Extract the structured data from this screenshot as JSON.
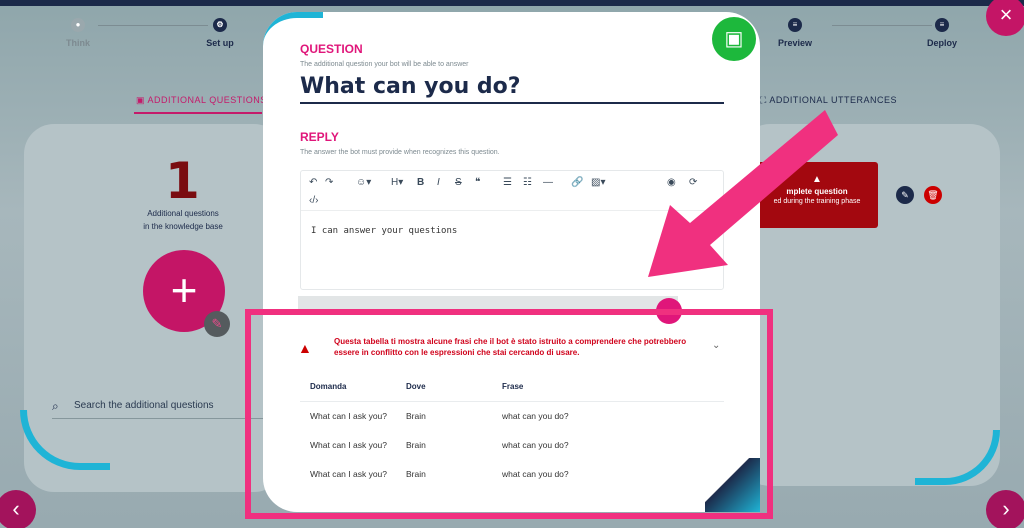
{
  "stepper": {
    "steps": [
      {
        "label": "Think",
        "icon": "lightbulb-icon"
      },
      {
        "label": "Set up",
        "icon": "gear-icon"
      },
      {
        "label": "Preview",
        "icon": "list-icon"
      },
      {
        "label": "Deploy",
        "icon": "list-icon"
      }
    ]
  },
  "tabs": {
    "left": "ADDITIONAL QUESTIONS",
    "right": "ADDITIONAL UTTERANCES"
  },
  "left_panel": {
    "count": "1",
    "count_label_1": "Additional questions",
    "count_label_2": "in the knowledge base",
    "add_symbol": "+",
    "search_placeholder": "Search the additional questions"
  },
  "right_panel": {
    "alert_title": "mplete question",
    "alert_sub": "ed during the training phase"
  },
  "modal": {
    "question_label": "QUESTION",
    "question_hint": "The additional question your bot will be able to answer",
    "question_value": "What can you do?",
    "reply_label": "REPLY",
    "reply_hint": "The answer the bot must provide when recognizes this question.",
    "reply_value": "I can answer your questions",
    "warning": "Questa tabella ti mostra alcune frasi che il bot è stato istruito a comprendere che potrebbero essere in conflitto con le espressioni che stai cercando di usare.",
    "table": {
      "headers": [
        "Domanda",
        "Dove",
        "Frase"
      ],
      "rows": [
        [
          "What can I ask you?",
          "Brain",
          "what can you do?"
        ],
        [
          "What can I ask you?",
          "Brain",
          "what can you do?"
        ],
        [
          "What can I ask you?",
          "Brain",
          "what can you do?"
        ]
      ]
    }
  },
  "colors": {
    "accent": "#e0167a",
    "navy": "#1c2a4a",
    "save": "#1db83c",
    "highlight": "#f0307f"
  }
}
